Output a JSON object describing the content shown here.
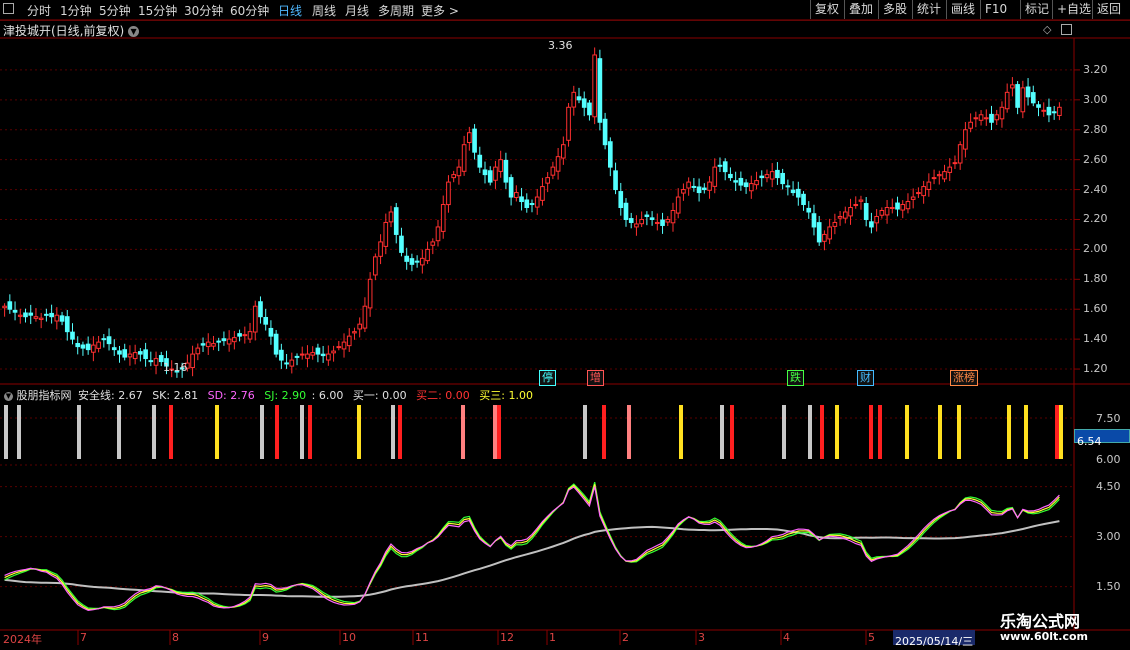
{
  "toolbar": {
    "periods": [
      "分时",
      "1分钟",
      "5分钟",
      "15分钟",
      "30分钟",
      "60分钟",
      "日线",
      "周线",
      "月线",
      "多周期",
      "更多 >"
    ],
    "active_period": "日线",
    "right_buttons": [
      "复权",
      "叠加",
      "多股",
      "统计",
      "画线",
      "F10",
      "标记",
      "+自选",
      "返回"
    ]
  },
  "stock": {
    "title": "津投城开(日线,前复权)",
    "high_label": "3.36",
    "low_label": "1.16"
  },
  "price_axis": [
    "3.20",
    "3.00",
    "2.80",
    "2.60",
    "2.40",
    "2.20",
    "2.00",
    "1.80",
    "1.60",
    "1.40",
    "1.20"
  ],
  "events": [
    {
      "label": "停",
      "color": "#4ff"
    },
    {
      "label": "增",
      "color": "#f55"
    },
    {
      "label": "跌",
      "color": "#4f4"
    },
    {
      "label": "财",
      "color": "#4bf"
    },
    {
      "label": "涨榜",
      "color": "#f84"
    }
  ],
  "indicator": {
    "name": "股朋指标网",
    "safe_label": "安全线: 2.67",
    "sk_label": "SK: 2.81",
    "sd_label": "SD: 2.76",
    "sj_label": "SJ: 2.90",
    "six_label": ": 6.00",
    "buy1_label": "买一: 0.00",
    "buy2_label": "买二: 0.00",
    "buy3_label": "买三: 1.00",
    "axis_top": [
      "7.50",
      "6.00"
    ],
    "current_value": "6.54",
    "axis_bottom": [
      "4.50",
      "3.00",
      "1.50"
    ]
  },
  "date_axis": [
    "2024年",
    "7",
    "8",
    "9",
    "10",
    "11",
    "12",
    "1",
    "2",
    "3",
    "4",
    "5"
  ],
  "cursor_date": "2025/05/14/三",
  "watermark": {
    "name": "乐淘公式网",
    "url": "www.60lt.com"
  },
  "colors": {
    "up": "#ff3030",
    "down": "#54ffff",
    "sk": "#ff66ff",
    "sd": "#ffff33",
    "sj": "#33ff33",
    "safe": "#c0c0c0",
    "grid": "#5a0000",
    "axis": "#8a0000"
  },
  "chart_data": {
    "type": "candlestick",
    "ylim": [
      1.1,
      3.4
    ],
    "closes": [
      1.62,
      1.6,
      1.58,
      1.56,
      1.55,
      1.56,
      1.55,
      1.54,
      1.56,
      1.55,
      1.56,
      1.52,
      1.45,
      1.4,
      1.35,
      1.34,
      1.33,
      1.36,
      1.38,
      1.4,
      1.37,
      1.33,
      1.3,
      1.28,
      1.3,
      1.31,
      1.3,
      1.27,
      1.25,
      1.27,
      1.25,
      1.22,
      1.2,
      1.18,
      1.2,
      1.24,
      1.3,
      1.34,
      1.36,
      1.38,
      1.37,
      1.38,
      1.39,
      1.4,
      1.41,
      1.42,
      1.43,
      1.45,
      1.62,
      1.55,
      1.5,
      1.42,
      1.3,
      1.26,
      1.24,
      1.26,
      1.28,
      1.3,
      1.3,
      1.31,
      1.3,
      1.29,
      1.3,
      1.32,
      1.35,
      1.38,
      1.42,
      1.45,
      1.5,
      1.62,
      1.8,
      1.95,
      2.05,
      2.18,
      2.25,
      2.1,
      1.98,
      1.92,
      1.9,
      1.92,
      1.94,
      2.0,
      2.05,
      2.15,
      2.3,
      2.45,
      2.5,
      2.55,
      2.7,
      2.78,
      2.65,
      2.55,
      2.5,
      2.45,
      2.55,
      2.6,
      2.45,
      2.35,
      2.38,
      2.32,
      2.28,
      2.3,
      2.35,
      2.42,
      2.48,
      2.55,
      2.62,
      2.7,
      2.95,
      3.05,
      3.0,
      2.95,
      2.9,
      3.3,
      2.85,
      2.7,
      2.55,
      2.4,
      2.28,
      2.2,
      2.18,
      2.17,
      2.2,
      2.22,
      2.2,
      2.18,
      2.16,
      2.2,
      2.26,
      2.35,
      2.4,
      2.45,
      2.42,
      2.38,
      2.4,
      2.45,
      2.55,
      2.56,
      2.52,
      2.48,
      2.45,
      2.43,
      2.42,
      2.44,
      2.46,
      2.48,
      2.5,
      2.52,
      2.48,
      2.44,
      2.42,
      2.38,
      2.35,
      2.3,
      2.25,
      2.15,
      2.05,
      2.1,
      2.15,
      2.18,
      2.22,
      2.25,
      2.28,
      2.3,
      2.33,
      2.2,
      2.15,
      2.22,
      2.26,
      2.28,
      2.28,
      2.27,
      2.3,
      2.32,
      2.35,
      2.38,
      2.42,
      2.45,
      2.48,
      2.5,
      2.52,
      2.55,
      2.58,
      2.7,
      2.8,
      2.85,
      2.88,
      2.9,
      2.88,
      2.85,
      2.9,
      2.95,
      3.05,
      3.1,
      2.95,
      3.08,
      3.02,
      2.98,
      2.95,
      2.93,
      2.9,
      2.92,
      2.95
    ]
  }
}
